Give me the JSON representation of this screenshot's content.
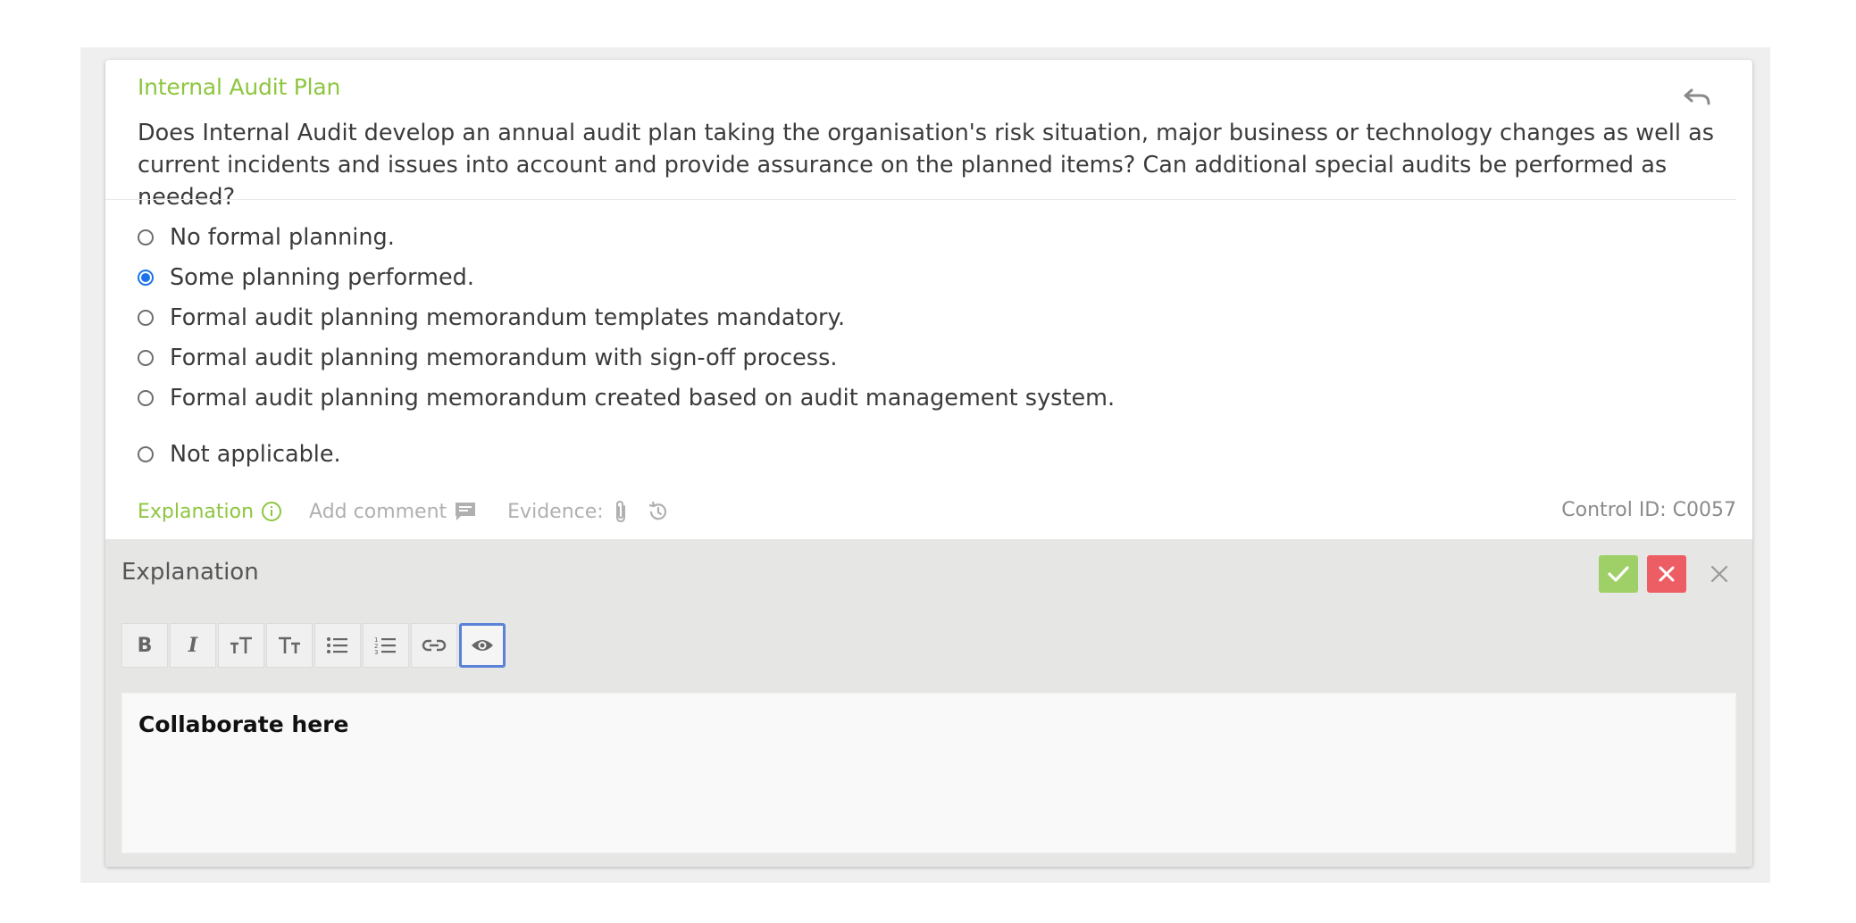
{
  "question": {
    "title": "Internal Audit Plan",
    "text": "Does Internal Audit develop an annual audit plan taking the organisation's risk situation, major business or technology changes as well as current incidents and issues into account and provide assurance on the planned items? Can additional special audits be performed as needed?",
    "options": [
      {
        "label": "No formal planning.",
        "checked": false
      },
      {
        "label": "Some planning performed.",
        "checked": true
      },
      {
        "label": "Formal audit planning memorandum templates mandatory.",
        "checked": false
      },
      {
        "label": "Formal audit planning memorandum with sign-off process.",
        "checked": false
      },
      {
        "label": "Formal audit planning memorandum created based on audit management system.",
        "checked": false
      },
      {
        "label": "Not applicable.",
        "checked": false
      }
    ]
  },
  "meta": {
    "explanation_label": "Explanation",
    "add_comment_label": "Add comment",
    "evidence_label": "Evidence:",
    "control_id": "Control ID: C0057"
  },
  "explanation_panel": {
    "title": "Explanation",
    "editor_text": "Collaborate here",
    "toolbar": [
      {
        "name": "bold",
        "glyph": "B"
      },
      {
        "name": "italic",
        "glyph": "I"
      },
      {
        "name": "heading-small",
        "glyph": "TT"
      },
      {
        "name": "heading-large",
        "glyph": "Tт"
      },
      {
        "name": "bullet-list",
        "glyph": ""
      },
      {
        "name": "numbered-list",
        "glyph": ""
      },
      {
        "name": "link",
        "glyph": ""
      },
      {
        "name": "preview",
        "glyph": ""
      }
    ]
  },
  "colors": {
    "accent_green": "#8dc63f",
    "radio_blue": "#1a73e8",
    "ok_button": "#9fd067",
    "cancel_button": "#ec5d64"
  }
}
